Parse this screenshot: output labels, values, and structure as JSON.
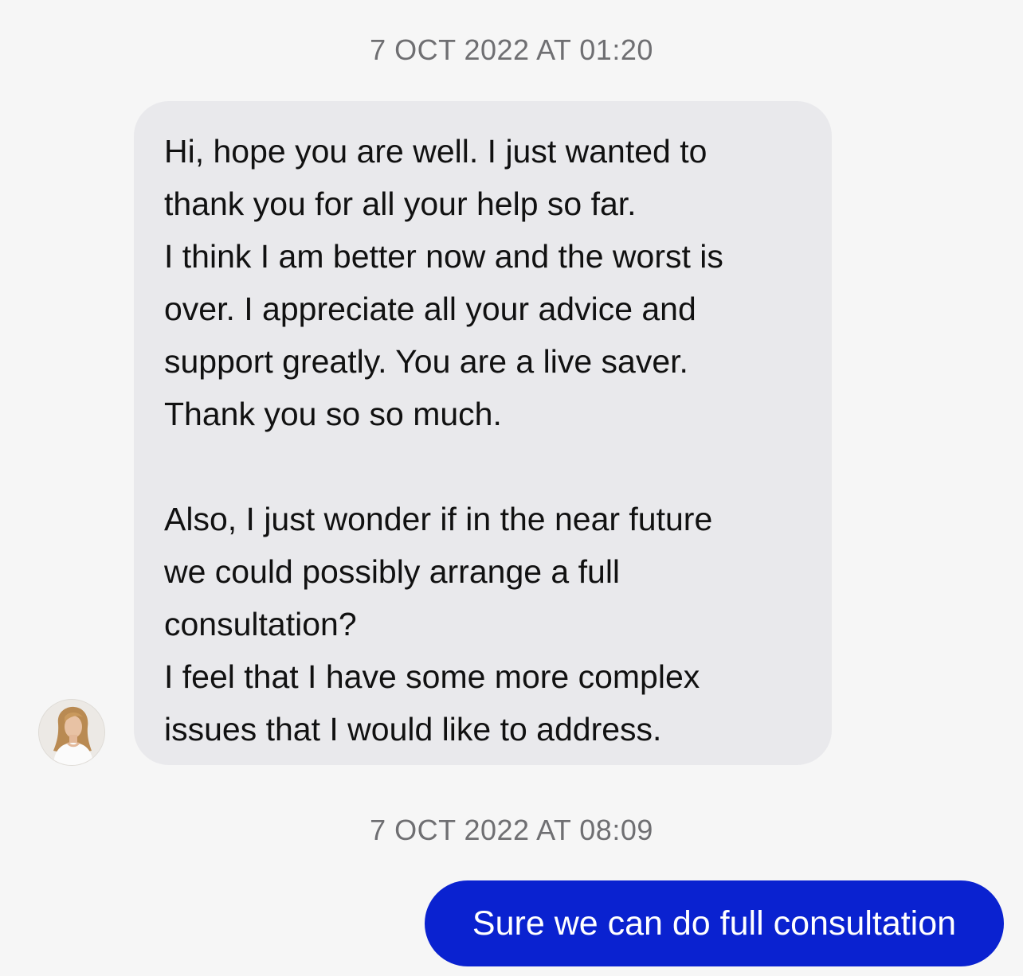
{
  "messages": [
    {
      "timestamp": "7 OCT 2022 AT 01:20",
      "direction": "incoming",
      "avatar_icon": "user-avatar-photo",
      "paragraphs": [
        [
          "Hi, hope you are well. I just wanted to",
          "thank you for all your help so far.",
          "I think I am better now and the worst is",
          "over. I appreciate all your advice and",
          "support greatly. You are a live saver.",
          "Thank you so so much."
        ],
        [
          "Also, I just wonder if in the near future",
          "we could possibly arrange a full",
          "consultation?",
          "I feel that I have some more complex",
          "issues that I would like to address."
        ]
      ]
    },
    {
      "timestamp": "7 OCT 2022 AT 08:09",
      "direction": "outgoing",
      "text": "Sure we can do full consultation"
    }
  ],
  "colors": {
    "background": "#f6f6f6",
    "incoming_bubble": "#e9e9ec",
    "outgoing_bubble": "#0a22d0",
    "timestamp_text": "#6f6f72"
  }
}
